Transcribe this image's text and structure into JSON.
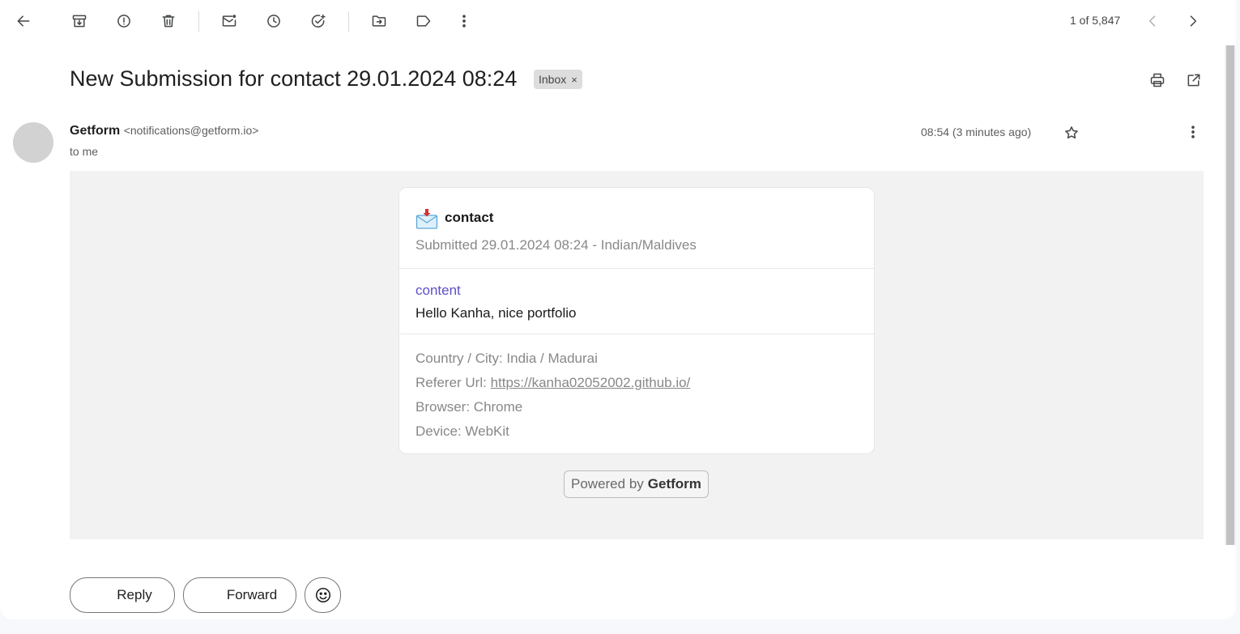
{
  "toolbar": {
    "icons": [
      "back-arrow-icon",
      "archive-icon",
      "report-spam-icon",
      "delete-icon",
      "mark-unread-icon",
      "snooze-icon",
      "add-task-icon",
      "move-to-icon",
      "label-icon",
      "more-vert-icon"
    ],
    "counter": "1 of 5,847"
  },
  "email": {
    "subject": "New Submission for contact 29.01.2024 08:24",
    "label": "Inbox",
    "label_remove": "×",
    "sender_name": "Getform",
    "sender_address": "<notifications@getform.io>",
    "recipient": "to me",
    "time": "08:54 (3 minutes ago)"
  },
  "card": {
    "form_name": "contact",
    "submitted": "Submitted 29.01.2024 08:24 - Indian/Maldives",
    "field_key": "content",
    "field_value": "Hello Kanha, nice portfolio",
    "country_city": "Country / City: India / Madurai",
    "referer_label": "Referer Url: ",
    "referer_url": "https://kanha02052002.github.io/",
    "browser": "Browser: Chrome",
    "device": "Device: WebKit"
  },
  "powered": {
    "prefix": "Powered by",
    "brand": "Getform"
  },
  "actions": {
    "reply": "Reply",
    "forward": "Forward"
  },
  "colors": {
    "accent_field_key": "#5b4fc9",
    "body_bg": "#f2f2f2"
  }
}
